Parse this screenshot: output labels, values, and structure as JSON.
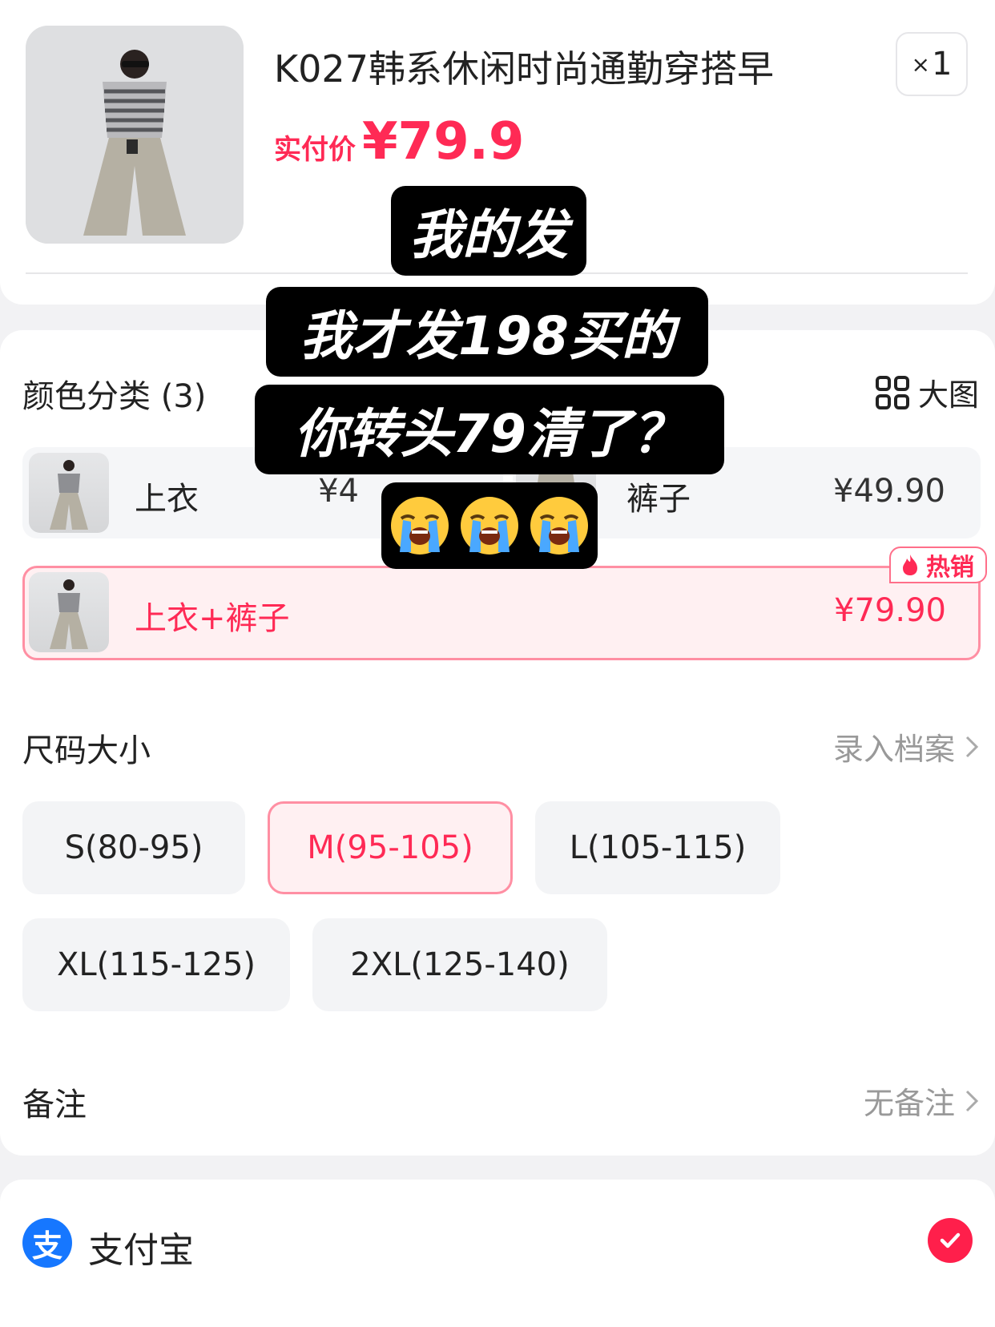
{
  "product": {
    "title": "K027韩系休闲时尚通勤穿搭早",
    "price_label": "实付价",
    "price_value": "¥79.9",
    "quantity_prefix": "×",
    "quantity": "1"
  },
  "color_section": {
    "title": "颜色分类 (3)",
    "view_large_label": "大图",
    "variants": [
      {
        "label": "上衣",
        "price": "¥4"
      },
      {
        "label": "裤子",
        "price": "¥49.90"
      },
      {
        "label": "上衣+裤子",
        "price": "¥79.90",
        "selected": true
      }
    ],
    "hot_badge": "热销"
  },
  "size_section": {
    "title": "尺码大小",
    "link_label": "录入档案",
    "sizes": [
      "S(80-95)",
      "M(95-105)",
      "L(105-115)",
      "XL(115-125)",
      "2XL(125-140)"
    ],
    "selected_size": "M(95-105)"
  },
  "note_section": {
    "title": "备注",
    "value": "无备注"
  },
  "payment": {
    "method": "支付宝",
    "icon_char": "支",
    "selected": true
  },
  "overlay_caption": {
    "lines": [
      "我的发",
      "我才发198买的",
      "你转头79清了？"
    ],
    "emoji": "loudly-crying-face-icon ×3"
  },
  "colors": {
    "accent": "#ff2a55",
    "alipay": "#1677ff",
    "selected_border": "#ff8fa3",
    "selected_bg": "#fff0f2"
  }
}
